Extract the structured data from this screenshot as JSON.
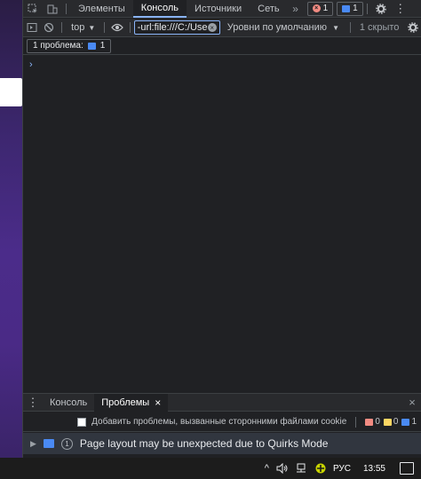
{
  "tabs": [
    {
      "label": "Элементы"
    },
    {
      "label": "Консоль"
    },
    {
      "label": "Источники"
    },
    {
      "label": "Сеть"
    }
  ],
  "badges": {
    "errors": "1",
    "messages": "1"
  },
  "toolbar": {
    "context": "top",
    "filter_value": "-url:file:///C:/Users/%",
    "levels": "Уровни по умолчанию",
    "hidden": "1 скрыто"
  },
  "issues_button": {
    "label": "1 проблема:",
    "count": "1"
  },
  "console": {
    "prompt": "›"
  },
  "drawer": {
    "tabs": [
      {
        "label": "Консоль"
      },
      {
        "label": "Проблемы"
      }
    ],
    "third_party_label": "Добавить проблемы, вызванные сторонними файлами cookie",
    "counts": {
      "red": "0",
      "yellow": "0",
      "blue": "1"
    },
    "issue": {
      "count": "1",
      "text": "Page layout may be unexpected due to Quirks Mode"
    }
  },
  "taskbar": {
    "language": "РУС",
    "time": "13:55"
  },
  "colors": {
    "accent": "#8ab4f8",
    "error": "#f28b82",
    "warning": "#fdd663",
    "info": "#4a8af4"
  }
}
